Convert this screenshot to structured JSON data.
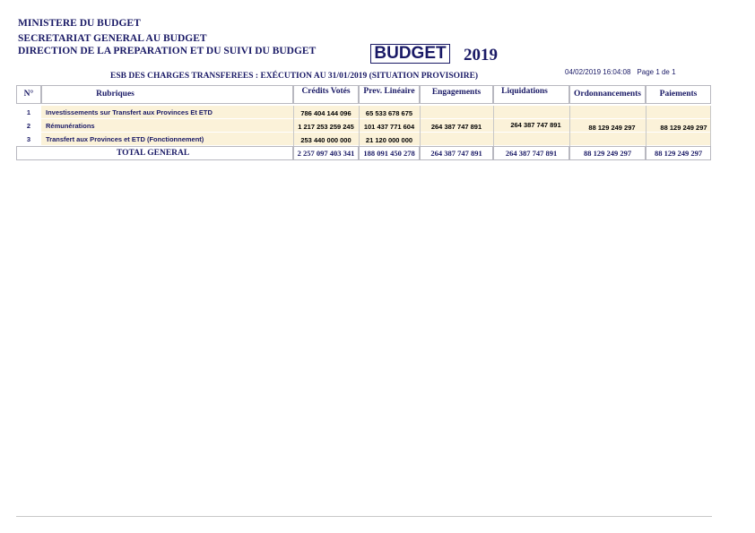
{
  "header": {
    "line1": "MINISTERE DU BUDGET",
    "line2": "SECRETARIAT GENERAL AU BUDGET",
    "line3": "DIRECTION DE LA PREPARATION ET DU SUIVI DU BUDGET",
    "budget_label": "BUDGET",
    "year": "2019",
    "timestamp": "04/02/2019 16:04:08",
    "page": "Page 1 de 1",
    "subtitle": "ESB DES CHARGES TRANSFEREES : EXÉCUTION AU 31/01/2019 (SITUATION PROVISOIRE)"
  },
  "table": {
    "columns": {
      "num": "N°",
      "rubriques": "Rubriques",
      "credits": "Crédits Votés",
      "prev": "Prev. Linéaire",
      "engagements": "Engagements",
      "liquidations": "Liquidations",
      "ordonnancements": "Ordonnancements",
      "paiements": "Paiements"
    },
    "rows": [
      {
        "num": "1",
        "rubrique": "Investissements sur Transfert aux Provinces Et ETD",
        "credits": "786 404 144 096",
        "prev": "65 533 678 675",
        "engagements": "",
        "liquidations": "",
        "ordonnancements": "",
        "paiements": ""
      },
      {
        "num": "2",
        "rubrique": "Rémunérations",
        "credits": "1 217 253 259 245",
        "prev": "101 437 771 604",
        "engagements": "264 387 747 891",
        "liquidations": "264 387 747 891",
        "ordonnancements": "88 129 249 297",
        "paiements": "88 129 249 297"
      },
      {
        "num": "3",
        "rubrique": "Transfert aux Provinces et ETD (Fonctionnement)",
        "credits": "253 440 000 000",
        "prev": "21 120 000 000",
        "engagements": "",
        "liquidations": "",
        "ordonnancements": "",
        "paiements": ""
      }
    ],
    "total": {
      "label": "TOTAL GENERAL",
      "credits": "2 257 097 403 341",
      "prev": "188 091 450 278",
      "engagements": "264 387 747 891",
      "liquidations": "264 387 747 891",
      "ordonnancements": "88 129 249 297",
      "paiements": "88 129 249 297"
    }
  }
}
